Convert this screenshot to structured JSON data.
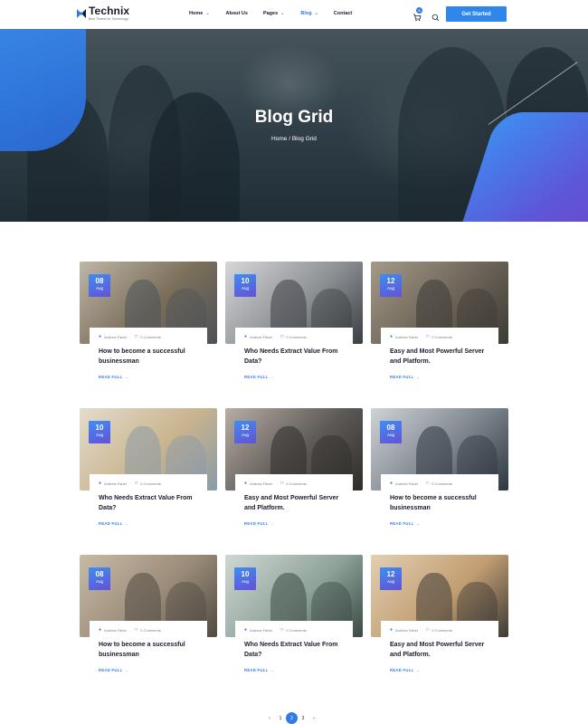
{
  "brand": {
    "name": "Technix",
    "tagline": "Best Theme for Technology"
  },
  "nav": [
    {
      "label": "Home",
      "dropdown": true,
      "active": false
    },
    {
      "label": "About Us",
      "dropdown": false,
      "active": false
    },
    {
      "label": "Pages",
      "dropdown": true,
      "active": false
    },
    {
      "label": "Blog",
      "dropdown": true,
      "active": true
    },
    {
      "label": "Contact",
      "dropdown": false,
      "active": false
    }
  ],
  "header": {
    "cart_count": "0",
    "cta_label": "Get Started"
  },
  "hero": {
    "title": "Blog Grid",
    "breadcrumb_home": "Home",
    "breadcrumb_sep": "/",
    "breadcrumb_current": "Blog Grid"
  },
  "posts": [
    {
      "day": "08",
      "month": "Aug",
      "author": "Andrew Faber",
      "comments": "0 Comments",
      "title": "How to become a successful businessman",
      "read_more": "READ FULL"
    },
    {
      "day": "10",
      "month": "Aug",
      "author": "Andrew Faber",
      "comments": "0 Comments",
      "title": "Who Needs Extract Value From Data?",
      "read_more": "READ FULL"
    },
    {
      "day": "12",
      "month": "Aug",
      "author": "Andrew Faber",
      "comments": "0 Comments",
      "title": "Easy and Most Powerful Server and Platform.",
      "read_more": "READ FULL"
    },
    {
      "day": "10",
      "month": "Aug",
      "author": "Andrew Faber",
      "comments": "0 Comments",
      "title": "Who Needs Extract Value From Data?",
      "read_more": "READ FULL"
    },
    {
      "day": "12",
      "month": "Aug",
      "author": "Andrew Faber",
      "comments": "0 Comments",
      "title": "Easy and Most Powerful Server and Platform.",
      "read_more": "READ FULL"
    },
    {
      "day": "08",
      "month": "Aug",
      "author": "Andrew Faber",
      "comments": "0 Comments",
      "title": "How to become a successful businessman",
      "read_more": "READ FULL"
    },
    {
      "day": "08",
      "month": "Aug",
      "author": "Andrew Faber",
      "comments": "0 Comments",
      "title": "How to become a successful businessman",
      "read_more": "READ FULL"
    },
    {
      "day": "10",
      "month": "Aug",
      "author": "Andrew Faber",
      "comments": "0 Comments",
      "title": "Who Needs Extract Value From Data?",
      "read_more": "READ FULL"
    },
    {
      "day": "12",
      "month": "Aug",
      "author": "Andrew Faber",
      "comments": "0 Comments",
      "title": "Easy and Most Powerful Server and Platform.",
      "read_more": "READ FULL"
    }
  ],
  "pagination": {
    "prev": "‹",
    "pages": [
      "1",
      "2",
      "3"
    ],
    "current": "2",
    "next": "›"
  },
  "colors": {
    "accent": "#2f7be8",
    "brand_purple": "#6551d6",
    "text": "#1b1d2e",
    "muted": "#7b7e90"
  },
  "icons": [
    "logo-mark-icon",
    "chevron-down-icon",
    "cart-icon",
    "search-icon",
    "user-icon",
    "comment-icon",
    "arrow-right-icon"
  ]
}
